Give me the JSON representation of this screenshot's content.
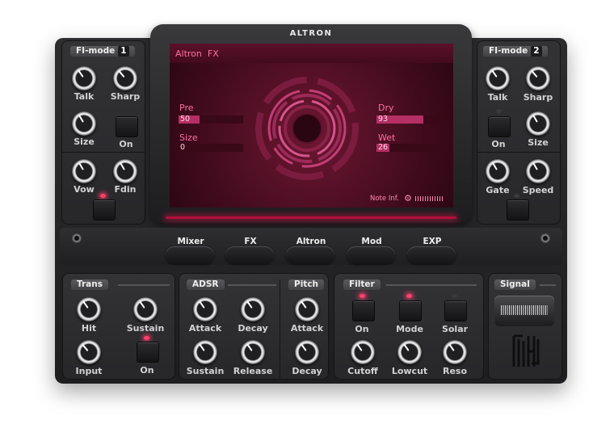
{
  "app": {
    "title": "ALTRON"
  },
  "colors": {
    "accent": "#ff4f86",
    "screen": "#4a0c20",
    "led_on": "#ff3f6c"
  },
  "left_module": {
    "tag": "FI-mode",
    "number": "1",
    "knobs": {
      "talk": "Talk",
      "sharp": "Sharp",
      "size": "Size",
      "vow": "Vow",
      "fdin": "Fdin"
    },
    "on_label": "On"
  },
  "right_module": {
    "tag": "FI-mode",
    "number": "2",
    "knobs": {
      "talk": "Talk",
      "sharp": "Sharp",
      "size": "Size",
      "gate": "Gate",
      "speed": "Speed"
    },
    "on_label": "On"
  },
  "screen": {
    "title": "Altron  FX",
    "params": {
      "pre": {
        "label": "Pre",
        "value": "50",
        "level": 0.32
      },
      "size": {
        "label": "Size",
        "value": "0",
        "level": 0.0
      },
      "dry": {
        "label": "Dry",
        "value": "93",
        "level": 0.73
      },
      "wet": {
        "label": "Wet",
        "value": "26",
        "level": 0.2
      }
    },
    "footer_label": "Note Inf."
  },
  "nav_tabs": [
    "Mixer",
    "FX",
    "Altron",
    "Mod",
    "EXP"
  ],
  "trans": {
    "tag": "Trans",
    "hit": "Hit",
    "sustain": "Sustain",
    "input": "Input",
    "on": "On"
  },
  "adsr": {
    "tag": "ADSR",
    "attack": "Attack",
    "decay": "Decay",
    "sustain": "Sustain",
    "release": "Release"
  },
  "pitch": {
    "tag": "Pitch",
    "attack": "Attack",
    "decay": "Decay"
  },
  "filter": {
    "tag": "Filter",
    "on": "On",
    "mode": "Mode",
    "solar": "Solar",
    "cutoff": "Cutoff",
    "lowcut": "Lowcut",
    "reso": "Reso"
  },
  "signal": {
    "tag": "Signal"
  }
}
